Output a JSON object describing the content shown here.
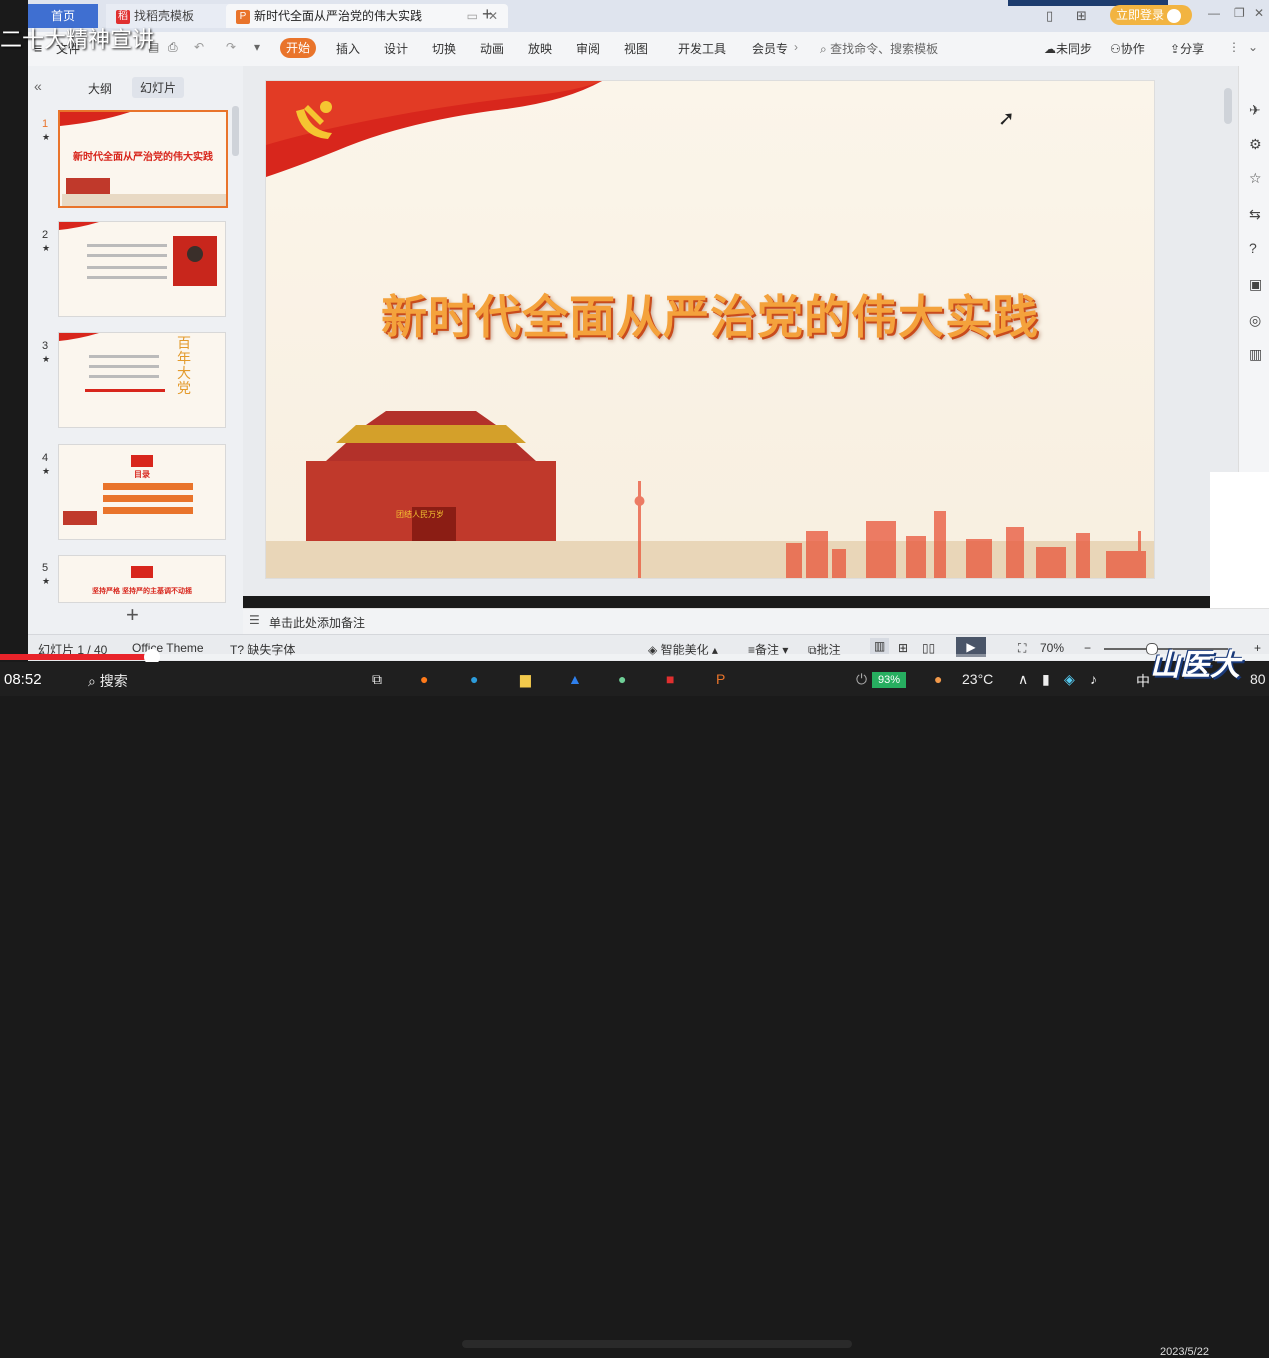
{
  "overlay": {
    "caption": "二十大精神宣讲",
    "logo": "山医大"
  },
  "tabs": {
    "home": "首页",
    "docer": "找稻壳模板",
    "doc": "新时代全面从严治党的伟大实践"
  },
  "account": {
    "login": "立即登录"
  },
  "ribbon": {
    "file": "文件",
    "start": "开始",
    "items": [
      "插入",
      "设计",
      "切换",
      "动画",
      "放映",
      "审阅",
      "视图",
      "开发工具",
      "会员专"
    ],
    "search_placeholder": "查找命令、搜索模板",
    "sync": "未同步",
    "collab": "协作",
    "share": "分享"
  },
  "leftpanel": {
    "tab_outline": "大纲",
    "tab_slides": "幻灯片",
    "slides": [
      {
        "num": "1",
        "title": "新时代全面从严治党的伟大实践"
      },
      {
        "num": "2",
        "title": ""
      },
      {
        "num": "3",
        "title": "百年大党"
      },
      {
        "num": "4",
        "title": "目录"
      },
      {
        "num": "5",
        "title": "坚持严格 坚持严的主基调不动摇"
      }
    ],
    "add": "+"
  },
  "slide": {
    "title": "新时代全面从严治党的伟大实践",
    "gate_banner": "团结人民万岁"
  },
  "notes": {
    "placeholder": "单击此处添加备注"
  },
  "status": {
    "slide_count": "幻灯片 1 / 40",
    "theme": "Office Theme",
    "missing_font": "缺失字体",
    "beautify": "智能美化",
    "notes": "备注",
    "comments": "批注",
    "zoom": "70%"
  },
  "video": {
    "progress": 0.12,
    "time": "08:52"
  },
  "taskbar": {
    "search": "搜索",
    "battery": "93%",
    "temperature": "23°C",
    "ime": "中",
    "date": "2023/5/22",
    "time_right": "80"
  },
  "colors": {
    "accent": "#e9742b",
    "party_red": "#d8261c",
    "title_orange": "#f4a23c"
  }
}
